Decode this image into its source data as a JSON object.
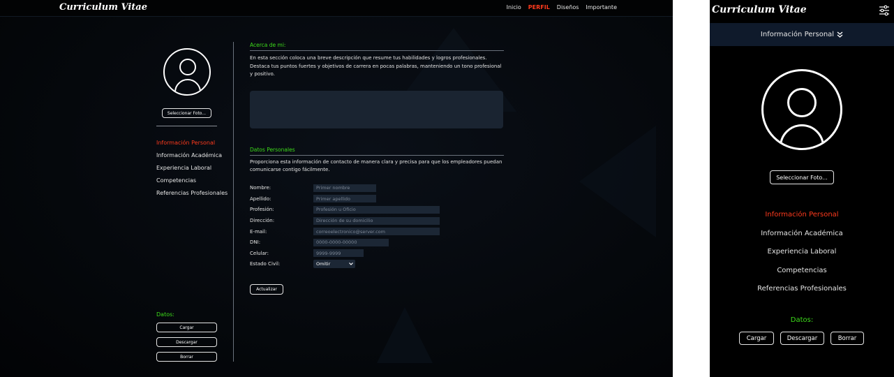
{
  "app": {
    "brand": "Curriculum Vitae"
  },
  "nav": {
    "items": [
      "Inicio",
      "PERFIL",
      "Diseños",
      "Importante"
    ],
    "active": "PERFIL"
  },
  "profile": {
    "select_photo_label": "Seleccionar Foto..."
  },
  "sidebar": {
    "items": [
      {
        "label": "Información Personal",
        "active": true
      },
      {
        "label": "Información Académica",
        "active": false
      },
      {
        "label": "Experiencia Laboral",
        "active": false
      },
      {
        "label": "Competencias",
        "active": false
      },
      {
        "label": "Referencias Profesionales",
        "active": false
      }
    ]
  },
  "data_section": {
    "title": "Datos:",
    "load_label": "Cargar",
    "download_label": "Descargar",
    "delete_label": "Borrar"
  },
  "about": {
    "title": "Acerca de mi:",
    "description": "En esta sección coloca una breve descripción que resume tus habilidades y logros profesionales. Destaca tus puntos fuertes y objetivos de carrera en pocas palabras, manteniendo un tono profesional y positivo.",
    "textarea_value": ""
  },
  "personal": {
    "title": "Datos Personales",
    "description": "Proporciona esta información de contacto de manera clara y precisa para que los empleadores puedan comunicarse contigo fácilmente.",
    "fields": [
      {
        "label": "Nombre:",
        "placeholder": "Primer nombre"
      },
      {
        "label": "Apellido:",
        "placeholder": "Primer apellido"
      },
      {
        "label": "Profesión:",
        "placeholder": "Profesión u Oficio"
      },
      {
        "label": "Dirección:",
        "placeholder": "Dirección de su domicilio"
      },
      {
        "label": "E-mail:",
        "placeholder": "correoelectronico@server.com"
      },
      {
        "label": "DNI:",
        "placeholder": "0000-0000-00000"
      },
      {
        "label": "Celular:",
        "placeholder": "9999-9999"
      }
    ],
    "civil_status": {
      "label": "Estado Civil:",
      "value": "Omitir"
    },
    "update_label": "Actualizar"
  },
  "mobile": {
    "dropdown_label": "Información Personal"
  },
  "colors": {
    "accent": "#ff3a1d",
    "section_title": "#3ddc1a",
    "input_bg": "#1c2735",
    "textarea_bg": "#1a2431",
    "mobile_dropdown_bg": "#0f1a2b"
  },
  "icons": {
    "menu": "sliders-icon",
    "dropdown": "double-chevron-down-icon",
    "avatar": "user-avatar-icon"
  }
}
